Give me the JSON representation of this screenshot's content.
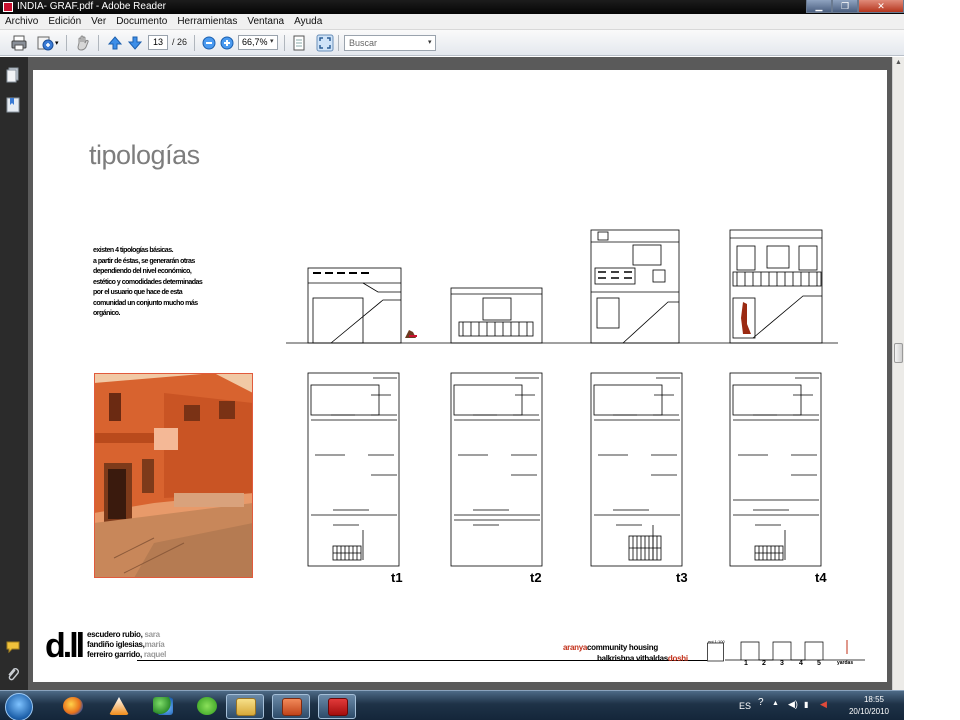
{
  "window": {
    "title": "INDIA- GRAF.pdf - Adobe Reader",
    "minimize_glyph": "▁",
    "maximize_glyph": "❐",
    "close_glyph": "✕"
  },
  "menu": [
    "Archivo",
    "Edición",
    "Ver",
    "Documento",
    "Herramientas",
    "Ventana",
    "Ayuda"
  ],
  "toolbar": {
    "page_current": "13",
    "page_total": "/ 26",
    "zoom": "66,7%",
    "search_placeholder": "Buscar",
    "dropdown_glyph": "▾",
    "icons": [
      "print-icon",
      "share-icon",
      "hand-tool-icon",
      "page-up-icon",
      "page-down-icon",
      "zoom-out-icon",
      "zoom-in-icon",
      "fit-page-icon",
      "full-screen-icon"
    ]
  },
  "sidebar": {
    "icons": [
      "pages-panel-icon",
      "bookmarks-panel-icon",
      "comments-icon",
      "attachments-icon"
    ]
  },
  "document": {
    "title": "tipologías",
    "intro_lines": [
      "existen 4 tipologías básicas.",
      "a partir de éstas, se generarán otras",
      "dependiendo del nivel económico,",
      "estético y comodidades determinadas",
      "por el usuario que hace de esta",
      "comunidad un conjunto mucho más",
      "orgánico."
    ],
    "type_labels": [
      "t1",
      "t2",
      "t3",
      "t4"
    ],
    "logo": "d.ll",
    "authors": [
      {
        "surname": "escudero rubio,",
        "given": "sara"
      },
      {
        "surname": "fandiño iglesias,",
        "given": "maría"
      },
      {
        "surname": "ferreiro garrido,",
        "given": "raquel"
      }
    ],
    "project": {
      "line1_red": "aranya",
      "line1_black": "community housing",
      "line2_black": "balkrishna vithaldas",
      "line2_red": "doshi"
    },
    "scale": {
      "labels": [
        "1",
        "2",
        "3",
        "4",
        "5"
      ],
      "unit": "yardas",
      "tag": "ent 1:100"
    }
  },
  "taskbar": {
    "apps": [
      "firefox-icon",
      "vlc-icon",
      "messenger-icon",
      "spotify-icon",
      "explorer-icon",
      "powerpoint-icon",
      "adobe-reader-icon"
    ],
    "active_app": "adobe-reader-icon",
    "language": "ES",
    "time": "18:55",
    "date": "20/10/2010"
  },
  "colors": {
    "accent_red": "#c2301a",
    "brick": "#d86b36",
    "title_gray": "#7d7d7d"
  }
}
